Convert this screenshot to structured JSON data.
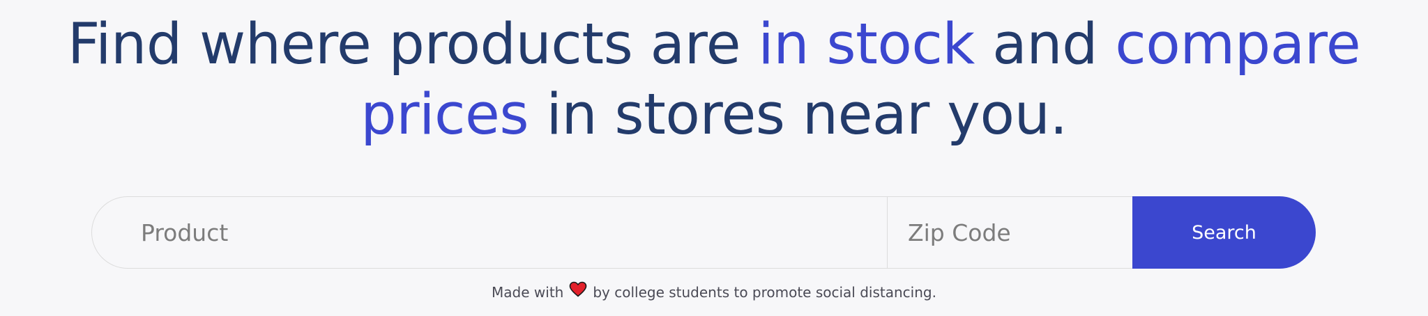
{
  "headline": {
    "part1": "Find where products are ",
    "accent1": "in stock",
    "part2": " and ",
    "accent2": "compare prices",
    "part3": " in stores near you."
  },
  "search": {
    "product_placeholder": "Product",
    "zip_placeholder": "Zip Code",
    "button_label": "Search"
  },
  "footer": {
    "before_icon": "Made with",
    "icon": "heart-icon",
    "after_icon": "by college students to promote social distancing."
  },
  "colors": {
    "headline": "#233b6b",
    "accent": "#3b47cf",
    "heart": "#e3212b"
  }
}
